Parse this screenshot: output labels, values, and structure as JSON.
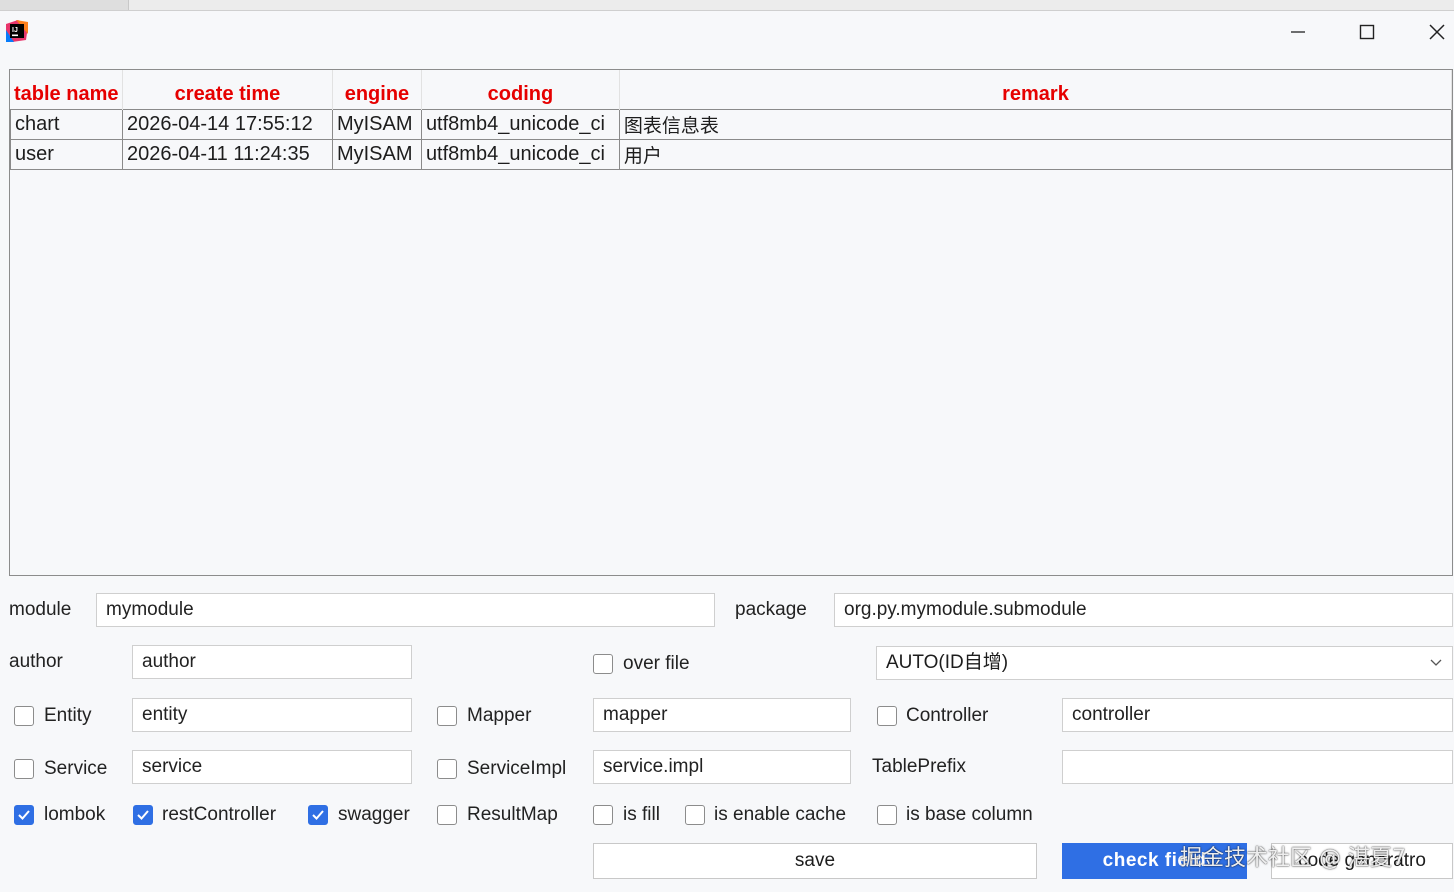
{
  "window": {
    "icon": "intellij-idea-icon",
    "controls": [
      "minimize-icon",
      "maximize-icon",
      "close-icon"
    ]
  },
  "table": {
    "headers": [
      "table name",
      "create time",
      "engine",
      "coding",
      "remark"
    ],
    "rows": [
      [
        "chart",
        "2026-04-14 17:55:12",
        "MyISAM",
        "utf8mb4_unicode_ci",
        "图表信息表"
      ],
      [
        "user",
        "2026-04-11 11:24:35",
        "MyISAM",
        "utf8mb4_unicode_ci",
        "用户"
      ]
    ],
    "header_color": "#e60000"
  },
  "form": {
    "module_label": "module",
    "module_value": "mymodule",
    "package_label": "package",
    "package_value": "org.py.mymodule.submodule",
    "author_label": "author",
    "author_value": "author",
    "over_file_label": "over file",
    "over_file_checked": false,
    "id_type_selected": "AUTO(ID自增)",
    "entity_label": "Entity",
    "entity_checked": false,
    "entity_value": "entity",
    "mapper_label": "Mapper",
    "mapper_checked": false,
    "mapper_value": "mapper",
    "controller_label": "Controller",
    "controller_checked": false,
    "controller_value": "controller",
    "service_label": "Service",
    "service_checked": false,
    "service_value": "service",
    "serviceimpl_label": "ServiceImpl",
    "serviceimpl_checked": false,
    "serviceimpl_value": "service.impl",
    "table_prefix_label": "TablePrefix",
    "table_prefix_value": "",
    "lombok_label": "lombok",
    "lombok_checked": true,
    "restcontroller_label": "restController",
    "restcontroller_checked": true,
    "swagger_label": "swagger",
    "swagger_checked": true,
    "resultmap_label": "ResultMap",
    "resultmap_checked": false,
    "is_fill_label": "is fill",
    "is_fill_checked": false,
    "is_enable_cache_label": "is enable cache",
    "is_enable_cache_checked": false,
    "is_base_column_label": "is base column",
    "is_base_column_checked": false
  },
  "buttons": {
    "save": "save",
    "check_field": "check field",
    "code_generator": "code generatro"
  },
  "watermark": "掘金技术社区 @ 湛夏7",
  "colors": {
    "accent": "#2f6fe4",
    "header_text": "#e60000",
    "background": "#f7f8fa"
  }
}
